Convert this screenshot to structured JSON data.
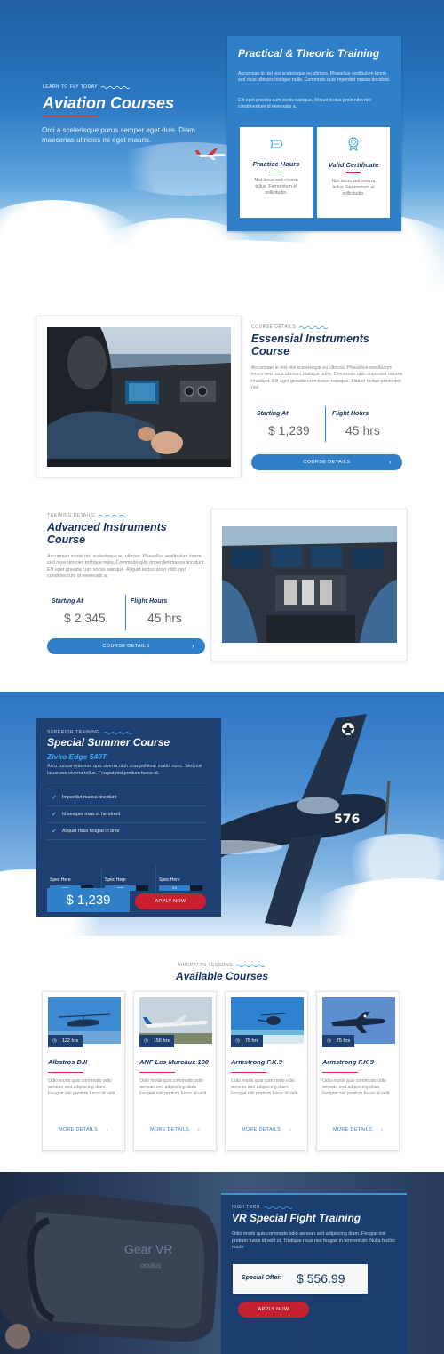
{
  "hero": {
    "kicker": "LEARN TO FLY TODAY",
    "title": "Aviation Courses",
    "subtitle": "Orci a scelerisque purus semper eget duis. Diam maecenas ultricies mi eget mauris.",
    "training": {
      "title": "Practical & Theoric Training",
      "p1": "Accumsan in nisl nisi scelerisque eu ultrices. Phasellus vestibulum lorem sed risus ultricies tristique nulla. Commodo quis imperdiet massa tincidunt.",
      "p2": "Elit eget gravida cum sociis natoque. Aliquet lectus proin nibh nisl condimentum id venenatis a.",
      "cards": [
        {
          "title": "Practice Hours",
          "text": "Nisi lacus sed viverra tellus. Fermentum et sollicitudin."
        },
        {
          "title": "Valid Certificate",
          "text": "Nisi lacus sed viverra tellus. Fermentum et sollicitudin."
        }
      ]
    }
  },
  "course1": {
    "kicker": "COURSE DETAILS",
    "title": "Essensial Instruments Course",
    "desc": "Accumsan in nisl nisi scelerisque eu ultrices. Phasellus vestibulum lorem sed risus ultricies tristique nulla. Commodo quis imperdiet massa tincidunt. Elit eget gravida cum sociis natoque. Aliquet lectus proin nibh nisl",
    "start_label": "Starting At",
    "start_value": "$ 1,239",
    "hours_label": "Flight Hours",
    "hours_value": "45 hrs",
    "button": "COURSE DETAILS"
  },
  "course2": {
    "kicker": "TRAINING DETAILS",
    "title": "Advanced Instruments Course",
    "desc": "Accumsan in nisl nisi scelerisque eu ultrices. Phasellus vestibulum lorem sed risus ultricies tristique nulla. Commodo quis imperdiet massa tincidunt. Elit eget gravida cum sociis natoque. Aliquet lectus proin nibh nisl condimentum id venenatis a.",
    "start_label": "Starting At",
    "start_value": "$ 2,345",
    "hours_label": "Flight Hours",
    "hours_value": "45 hrs",
    "button": "COURSE DETAILS"
  },
  "summer": {
    "kicker": "SUPERIOR TRAINING",
    "title": "Special Summer Course",
    "subtitle": "Zivko Edge 540T",
    "desc": "Arcu cursus euismod quis viverra nibh cras pulvinar mattis nunc. Sed nisi lacus sed viverra tellus. Feugiat nisl pretium fusce id.",
    "features": [
      "Imperdiet massa tincidunt",
      "Id semper risus in hendrerit",
      "Aliquet risus feugiat in ante"
    ],
    "specs": [
      {
        "label": "Spec Here",
        "value": "mph",
        "level": 0.72
      },
      {
        "label": "Spec Here",
        "value": "km/h",
        "level": 0.72
      },
      {
        "label": "Spec Here",
        "value": "ft-lt",
        "level": 0.72
      }
    ],
    "price": "$ 1,239",
    "button": "APPLY NOW",
    "plane_number": "576"
  },
  "available": {
    "kicker": "AIRCRAFTS LESSONS",
    "title": "Available Courses",
    "cards": [
      {
        "name": "Albatros D.II",
        "hours": "122 hrs",
        "text": "Odio morbi quis commodo odio aenean sed adipiscing diam. Feugiat nisl pretium fusce id velit",
        "more": "MORE DETAILS"
      },
      {
        "name": "ANF Les Mureaux 190",
        "hours": "156 hrs",
        "text": "Odio morbi quis commodo odio aenean sed adipiscing diam. Feugiat nisl pretium fusce id velit",
        "more": "MORE DETAILS"
      },
      {
        "name": "Armstrong F.K.9",
        "hours": "75 hrs",
        "text": "Odio morbi quis commodo odio aenean sed adipiscing diam. Feugiat nisl pretium fusce id velit",
        "more": "MORE DETAILS"
      },
      {
        "name": "Armstrong F.K.9",
        "hours": "75 hrs",
        "text": "Odio morbi quis commodo odio aenean sed adipiscing diam. Feugiat nisl pretium fusce id velit",
        "more": "MORE DETAILS"
      }
    ]
  },
  "vr": {
    "kicker": "HIGH TECH",
    "title": "VR Special Fight Training",
    "desc": "Odio morbi quis commodo odio aenean sed adipiscing diam. Feugiat nisl pretium fusce id velit ut. Tristique risus nec feugiat in fermentum. Nulla facilisi morbi",
    "offer_label": "Special Offer:",
    "offer_price": "$ 556.99",
    "button": "APPLY NOW",
    "headset_brand": "Gear VR",
    "headset_sub": "oculus"
  },
  "colors": {
    "primary": "#2f7fc9",
    "navy": "#1d3f72",
    "accent_red": "#d32f3f",
    "title_navy": "#15305a"
  }
}
